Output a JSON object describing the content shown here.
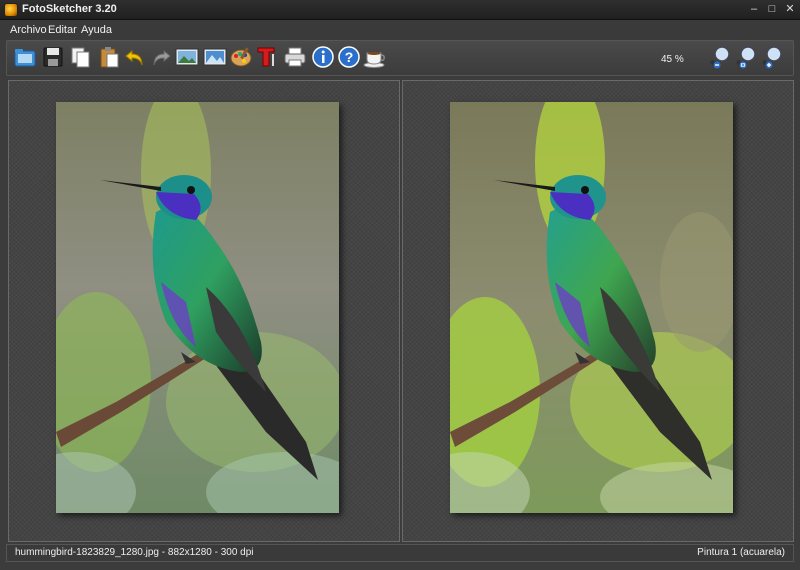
{
  "window": {
    "title": "FotoSketcher 3.20"
  },
  "menu": {
    "items": [
      "Archivo",
      "Editar",
      "Ayuda"
    ]
  },
  "toolbar": {
    "icons": [
      "open-folder-icon",
      "save-icon",
      "copy-icon",
      "paste-icon",
      "undo-icon",
      "redo-icon",
      "show-original-icon",
      "show-result-icon",
      "palette-icon",
      "text-icon",
      "print-icon",
      "info-icon",
      "help-icon",
      "coffee-icon"
    ],
    "zoom_level": "45 %",
    "zoom_icons": [
      "zoom-out-icon",
      "zoom-fit-icon",
      "zoom-in-icon"
    ]
  },
  "status": {
    "file_info": "hummingbird-1823829_1280.jpg - 882x1280 - 300 dpi",
    "effect": "Pintura 1 (acuarela)"
  },
  "colors": {
    "background": "#3c3c3c",
    "panel": "#444444",
    "accent": "#e08a00"
  }
}
